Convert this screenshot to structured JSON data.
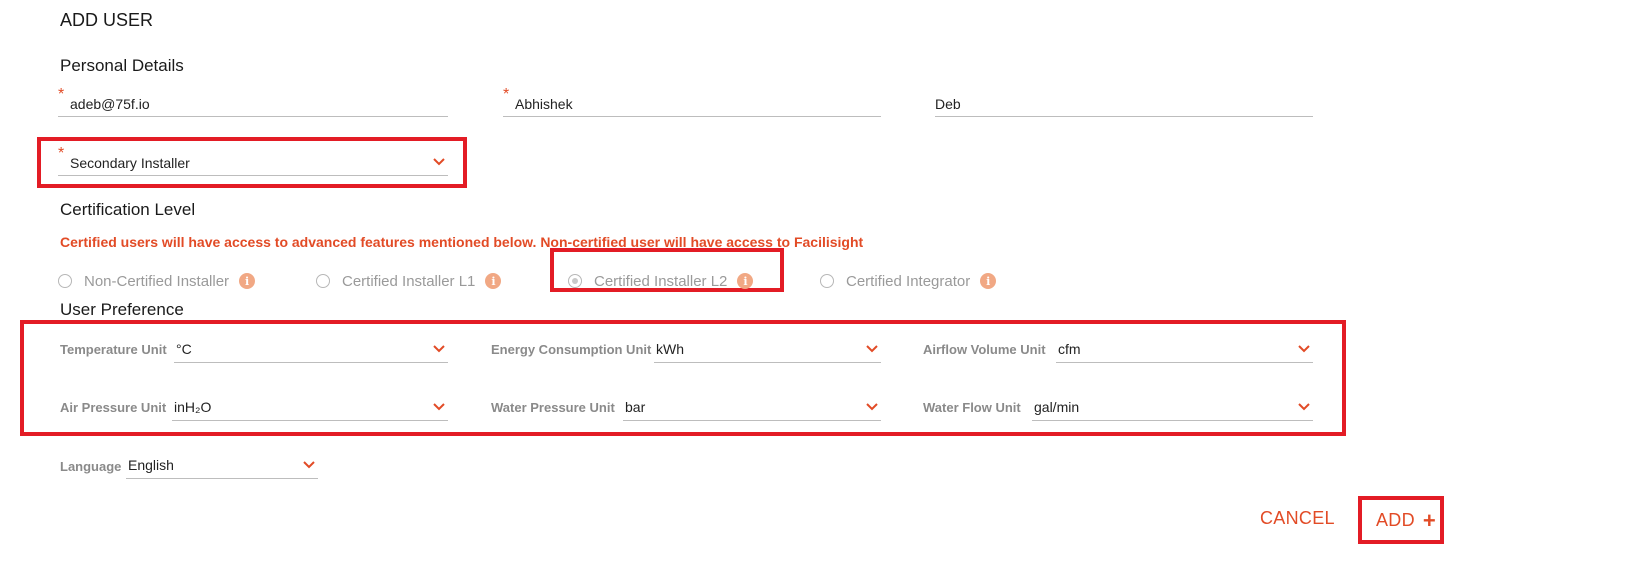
{
  "page_title": "ADD USER",
  "sections": {
    "personal_details": "Personal Details",
    "certification_level": "Certification Level",
    "user_preference": "User Preference"
  },
  "personal": {
    "email": "adeb@75f.io",
    "first_name": "Abhishek",
    "last_name": "Deb",
    "role": "Secondary Installer"
  },
  "certification": {
    "note": "Certified users will have access to advanced features mentioned below. Non-certified user will have access to Facilisight",
    "options": [
      {
        "label": "Non-Certified Installer",
        "selected": false
      },
      {
        "label": "Certified Installer L1",
        "selected": false
      },
      {
        "label": "Certified Installer L2",
        "selected": true
      },
      {
        "label": "Certified Integrator",
        "selected": false
      }
    ],
    "info_glyph": "i"
  },
  "preferences": {
    "temperature": {
      "label": "Temperature Unit",
      "value": "°C"
    },
    "energy": {
      "label": "Energy Consumption Unit",
      "value": "kWh"
    },
    "airflow": {
      "label": "Airflow Volume Unit",
      "value": "cfm"
    },
    "air_pressure": {
      "label": "Air Pressure Unit",
      "value": "inH₂O"
    },
    "water_pressure": {
      "label": "Water Pressure Unit",
      "value": "bar"
    },
    "water_flow": {
      "label": "Water Flow Unit",
      "value": "gal/min"
    },
    "language": {
      "label": "Language",
      "value": "English"
    }
  },
  "actions": {
    "cancel": "CANCEL",
    "add": "ADD"
  },
  "colors": {
    "accent": "#e24b26",
    "highlight": "#e31c25"
  },
  "icons": {
    "dropdown": "chevron-down-icon",
    "info": "info-icon",
    "add": "plus-icon"
  }
}
